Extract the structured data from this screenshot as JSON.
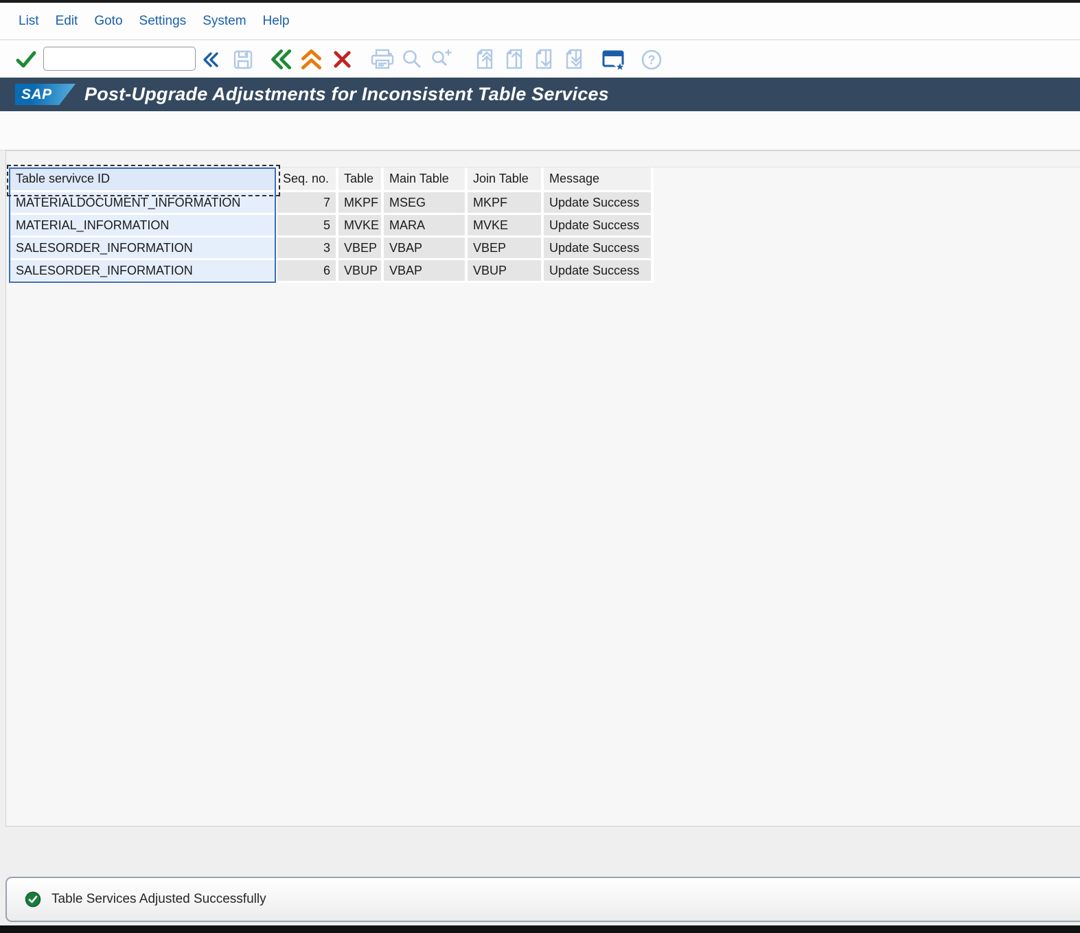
{
  "menu_bar": {
    "items": [
      "List",
      "Edit",
      "Goto",
      "Settings",
      "System",
      "Help"
    ]
  },
  "toolbar": {
    "command_field": {
      "value": "",
      "placeholder": ""
    },
    "buttons": [
      "enter-check",
      "command-collapse",
      "save",
      "back",
      "exit",
      "cancel",
      "print",
      "find",
      "find-next",
      "first-page",
      "page-up",
      "page-down",
      "last-page",
      "create-shortcut",
      "help"
    ]
  },
  "title_bar": {
    "logo_text": "SAP",
    "title": "Post-Upgrade Adjustments for Inconsistent Table Services"
  },
  "report_table": {
    "columns": [
      "Table servivce ID",
      "Seq. no.",
      "Table",
      "Main Table",
      "Join Table",
      "Message"
    ],
    "selected_column": "Table servivce ID",
    "rows": [
      [
        "MATERIALDOCUMENT_INFORMATION",
        "7",
        "MKPF",
        "MSEG",
        "MKPF",
        "Update Success"
      ],
      [
        "MATERIAL_INFORMATION",
        "5",
        "MVKE",
        "MARA",
        "MVKE",
        "Update Success"
      ],
      [
        "SALESORDER_INFORMATION",
        "3",
        "VBEP",
        "VBAP",
        "VBEP",
        "Update Success"
      ],
      [
        "SALESORDER_INFORMATION",
        "6",
        "VBUP",
        "VBAP",
        "VBUP",
        "Update Success"
      ]
    ]
  },
  "status_bar": {
    "icon": "success-check-icon",
    "message": "Table Services Adjusted Successfully"
  },
  "colors": {
    "title_bar_bg": "#34495f",
    "menu_text": "#1a60ab",
    "accent_blue": "#1c5da9",
    "pale_icon_blue": "#b0c8e6",
    "success_green": "#1f8a35",
    "warning_orange": "#e87c0e",
    "error_red": "#c32222",
    "selected_col_header_bg": "#dde9f8",
    "selected_col_cell_bg": "#e5eefb",
    "header_cell_bg": "#f1f1f1",
    "data_cell_bg": "#e5e5e5",
    "selection_border_blue": "#3a6db8"
  }
}
